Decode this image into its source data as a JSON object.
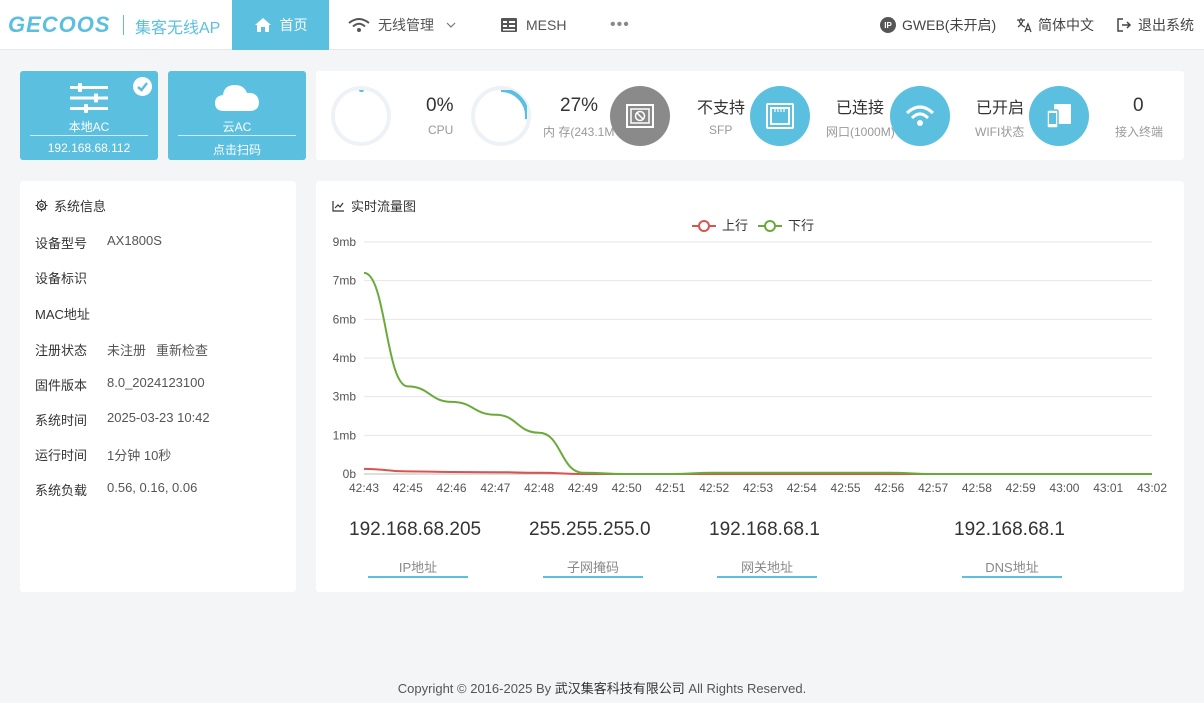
{
  "header": {
    "logo": "GECOOS",
    "subtitle": "集客无线AP",
    "nav": [
      {
        "label": "首页",
        "icon": "home-icon"
      },
      {
        "label": "无线管理",
        "icon": "wifi-icon"
      },
      {
        "label": "MESH",
        "icon": "mesh-icon"
      },
      {
        "label": "•••",
        "icon": "more-icon"
      }
    ],
    "right": {
      "gweb": "GWEB(未开启)",
      "ip_badge": "IP",
      "language": "简体中文",
      "logout": "退出系统"
    }
  },
  "ac_cards": [
    {
      "title": "本地AC",
      "sub": "192.168.68.112",
      "icon": "sliders-icon",
      "checked": true
    },
    {
      "title": "云AC",
      "sub": "点击扫码",
      "icon": "cloud-icon"
    }
  ],
  "stats": {
    "cpu": {
      "value": "0%",
      "label": "CPU",
      "percent": 0
    },
    "memory": {
      "value": "27%",
      "label": "内 存(243.1M",
      "percent": 27
    },
    "sfp": {
      "value": "不支持",
      "label": "SFP",
      "icon": "sfp-disabled-icon"
    },
    "port": {
      "value": "已连接",
      "label": "网口(1000M)",
      "icon": "ethernet-port-icon"
    },
    "wifi": {
      "value": "已开启",
      "label": "WIFI状态",
      "icon": "wifi-icon"
    },
    "clients": {
      "value": "0",
      "label": "接入终端",
      "icon": "devices-icon"
    }
  },
  "sysinfo": {
    "title": "系统信息",
    "model_label": "设备型号",
    "model": "AX1800S",
    "id_label": "设备标识",
    "id": "",
    "mac_label": "MAC地址",
    "mac": "",
    "reg_label": "注册状态",
    "reg_status": "未注册",
    "recheck": "重新检查",
    "fw_label": "固件版本",
    "firmware": "8.0_2024123100",
    "time_label": "系统时间",
    "time": "2025-03-23 10:42",
    "uptime_label": "运行时间",
    "uptime": "1分钟 10秒",
    "load_label": "系统负载",
    "load": "0.56, 0.16, 0.06"
  },
  "traffic": {
    "title": "实时流量图"
  },
  "chart_data": {
    "type": "line",
    "title": "实时流量图",
    "categories": [
      "42:43",
      "42:45",
      "42:46",
      "42:47",
      "42:48",
      "42:49",
      "42:50",
      "42:51",
      "42:52",
      "42:53",
      "42:54",
      "42:55",
      "42:56",
      "42:57",
      "42:58",
      "42:59",
      "43:00",
      "43:01",
      "43:02"
    ],
    "y_ticks": [
      "0b",
      "1mb",
      "3mb",
      "4mb",
      "6mb",
      "7mb",
      "9mb"
    ],
    "ylim": [
      0,
      9
    ],
    "grid": true,
    "legend_position": "top-center",
    "series": [
      {
        "name": "上行",
        "color": "#d9534f",
        "values": [
          0.2,
          0.1,
          0.08,
          0.07,
          0.05,
          0.0,
          0.0,
          0.0,
          0.0,
          0.0,
          0.0,
          0.0,
          0.0,
          0.0,
          0.0,
          0.0,
          0.0,
          0.0,
          0.0
        ]
      },
      {
        "name": "下行",
        "color": "#6aaa3a",
        "values": [
          7.8,
          3.4,
          2.8,
          2.3,
          1.6,
          0.05,
          0.0,
          0.0,
          0.05,
          0.05,
          0.05,
          0.05,
          0.05,
          0.0,
          0.0,
          0.0,
          0.0,
          0.0,
          0.0
        ]
      }
    ]
  },
  "network": [
    {
      "value": "192.168.68.205",
      "label": "IP地址"
    },
    {
      "value": "255.255.255.0",
      "label": "子网掩码"
    },
    {
      "value": "192.168.68.1",
      "label": "网关地址"
    },
    {
      "value": "192.168.68.1",
      "label": "DNS地址"
    }
  ],
  "footer": {
    "prefix": "Copyright © 2016-2025 By ",
    "company": "武汉集客科技有限公司",
    "suffix": " All Rights Reserved."
  }
}
